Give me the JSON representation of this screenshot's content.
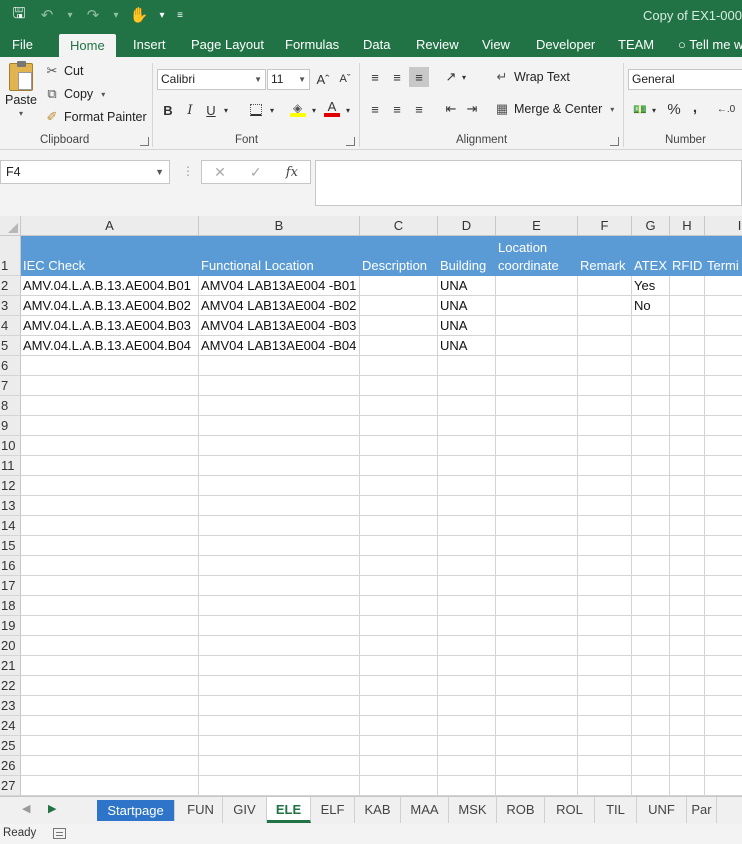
{
  "window": {
    "title": "Copy of EX1-000",
    "qat": {
      "save": "save-icon",
      "undo": "undo-icon",
      "redo": "redo-icon",
      "touch": "touch-mode-icon",
      "customize": "customize-qat-icon"
    }
  },
  "ribbon_tabs": [
    "File",
    "Home",
    "Insert",
    "Page Layout",
    "Formulas",
    "Data",
    "Review",
    "View",
    "Developer",
    "TEAM",
    "Tell me w"
  ],
  "active_ribbon_tab": "Home",
  "ribbon": {
    "clipboard": {
      "paste": "Paste",
      "cut": "Cut",
      "copy": "Copy",
      "format_painter": "Format Painter",
      "label": "Clipboard"
    },
    "font": {
      "name": "Calibri",
      "size": "11",
      "bold": "B",
      "italic": "I",
      "underline": "U",
      "label": "Font"
    },
    "alignment": {
      "wrap_text": "Wrap Text",
      "merge_center": "Merge & Center",
      "label": "Alignment"
    },
    "number": {
      "format": "General",
      "percent": "%",
      "comma": ",",
      "label": "Number"
    }
  },
  "formula_bar": {
    "name_box": "F4",
    "value": ""
  },
  "grid": {
    "columns": [
      {
        "letter": "A",
        "w": 178
      },
      {
        "letter": "B",
        "w": 161
      },
      {
        "letter": "C",
        "w": 78
      },
      {
        "letter": "D",
        "w": 58
      },
      {
        "letter": "E",
        "w": 82
      },
      {
        "letter": "F",
        "w": 54
      },
      {
        "letter": "G",
        "w": 38
      },
      {
        "letter": "H",
        "w": 35
      },
      {
        "letter": "I",
        "w": 70
      }
    ],
    "row_numbers": [
      "1",
      "2",
      "3",
      "4",
      "5",
      "6",
      "7",
      "8",
      "9",
      "10",
      "11",
      "12",
      "13",
      "14",
      "15",
      "16",
      "17",
      "18",
      "19",
      "20",
      "21",
      "22",
      "23",
      "24",
      "25",
      "26",
      "27"
    ],
    "header_row": [
      "IEC Check",
      "Functional Location",
      "Description",
      "Building",
      "Location\ncoordinate",
      "Remark",
      "ATEX",
      "RFID",
      "Termi"
    ],
    "rows": [
      [
        "AMV.04.L.A.B.13.AE004.B01",
        "AMV04 LAB13AE004 -B01",
        "",
        "UNA",
        "",
        "",
        "Yes",
        "",
        ""
      ],
      [
        "AMV.04.L.A.B.13.AE004.B02",
        "AMV04 LAB13AE004 -B02",
        "",
        "UNA",
        "",
        "",
        "No",
        "",
        ""
      ],
      [
        "AMV.04.L.A.B.13.AE004.B03",
        "AMV04 LAB13AE004 -B03",
        "",
        "UNA",
        "",
        "",
        "",
        "",
        ""
      ],
      [
        "AMV.04.L.A.B.13.AE004.B04",
        "AMV04 LAB13AE004 -B04",
        "",
        "UNA",
        "",
        "",
        "",
        "",
        ""
      ]
    ]
  },
  "sheet_tabs": [
    "Startpage",
    "FUN",
    "GIV",
    "ELE",
    "ELF",
    "KAB",
    "MAA",
    "MSK",
    "ROB",
    "ROL",
    "TIL",
    "UNF",
    "Par"
  ],
  "active_sheet": "ELE",
  "colored_sheet": "Startpage",
  "status": {
    "text": "Ready"
  }
}
